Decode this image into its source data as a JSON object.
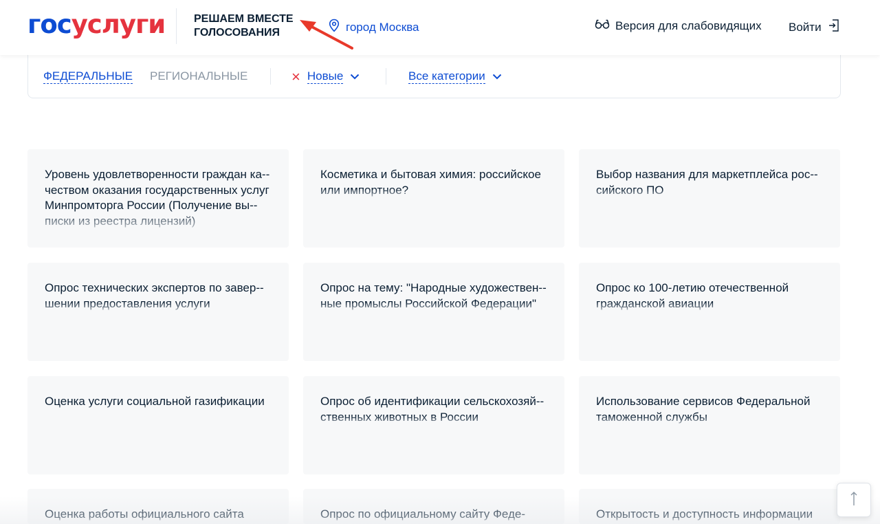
{
  "header": {
    "logo_part1": "гос",
    "logo_part2": "услуги",
    "project_title_line1": "РЕШАЕМ ВМЕСТЕ",
    "project_title_line2": "ГОЛОСОВАНИЯ",
    "location": "город Москва",
    "accessibility": "Версия для слабовидящих",
    "login": "Войти"
  },
  "filters": {
    "tab_federal": "ФЕДЕРАЛЬНЫЕ",
    "tab_regional": "РЕГИОНАЛЬНЫЕ",
    "sort_label": "Новые",
    "category_label": "Все категории"
  },
  "cards": [
    {
      "title": "Уровень удовлетворенности граждан ка-­чеством оказания государственных услуг Минпромторга России (Получение вы-­писки из реестра лицензий)"
    },
    {
      "title": "Косметика и бытовая химия: российское или импортное?"
    },
    {
      "title": "Выбор названия для маркетплейса рос-­сийского ПО"
    },
    {
      "title": "Опрос технических экспертов по завер-­шении предоставления услуги"
    },
    {
      "title": "Опрос на тему: \"Народные художествен-­ные промыслы Российской Федерации\""
    },
    {
      "title": "Опрос ко 100-летию отечественной гражданской авиации"
    },
    {
      "title": "Оценка услуги социальной газификации"
    },
    {
      "title": "Опрос об идентификации сельскохозяй-­ственных животных в России"
    },
    {
      "title": "Использование сервисов Федеральной таможенной службы"
    },
    {
      "title": "Оценка работы официального сайта"
    },
    {
      "title": "Опрос по официальному сайту Феде-"
    },
    {
      "title": "Открытость и доступность информации"
    }
  ],
  "colors": {
    "brand_blue": "#0d4cd3",
    "brand_red": "#e5333e",
    "card_bg": "#f7f8f9",
    "annotation_arrow": "#e8392a"
  },
  "icons": {
    "location": "location-pin-icon",
    "accessibility": "glasses-icon",
    "login": "login-icon",
    "sort_clear": "close-icon",
    "dropdown": "chevron-down-icon",
    "scroll_top": "arrow-up-icon"
  }
}
